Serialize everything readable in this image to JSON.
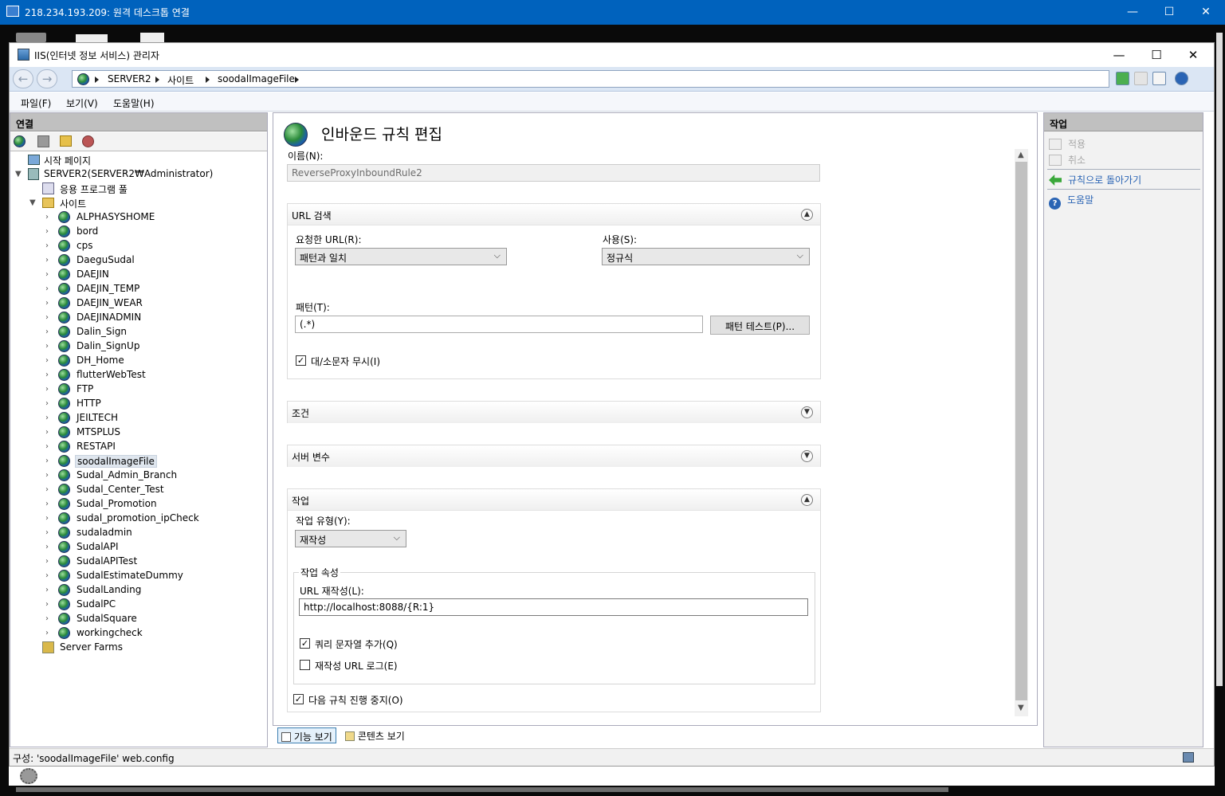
{
  "rdp": {
    "title": "218.234.193.209: 원격 데스크톱 연결",
    "minimize": "—",
    "maximize": "☐",
    "close": "✕"
  },
  "iis": {
    "title": "IIS(인터넷 정보 서비스) 관리자",
    "minimize": "—",
    "maximize": "☐",
    "close": "✕",
    "nav": {
      "back": "←",
      "forward": "→",
      "crumbs": [
        "SERVER2",
        "사이트",
        "soodalImageFile"
      ]
    },
    "menu": {
      "file": "파일(F)",
      "view": "보기(V)",
      "help": "도움말(H)"
    },
    "connections": {
      "header": "연결",
      "start_page": "시작 페이지",
      "server": "SERVER2(SERVER2₩Administrator)",
      "app_pools": "응용 프로그램 풀",
      "sites": "사이트",
      "site_list": [
        "ALPHASYSHOME",
        "bord",
        "cps",
        "DaeguSudal",
        "DAEJIN",
        "DAEJIN_TEMP",
        "DAEJIN_WEAR",
        "DAEJINADMIN",
        "Dalin_Sign",
        "Dalin_SignUp",
        "DH_Home",
        "flutterWebTest",
        "FTP",
        "HTTP",
        "JEILTECH",
        "MTSPLUS",
        "RESTAPI",
        "soodalImageFile",
        "Sudal_Admin_Branch",
        "Sudal_Center_Test",
        "Sudal_Promotion",
        "sudal_promotion_ipCheck",
        "sudaladmin",
        "SudalAPI",
        "SudalAPITest",
        "SudalEstimateDummy",
        "SudalLanding",
        "SudalPC",
        "SudalSquare",
        "workingcheck"
      ],
      "selected_site": "soodalImageFile",
      "server_farms": "Server Farms"
    },
    "editor": {
      "title": "인바운드 규칙 편집",
      "name_label": "이름(N):",
      "name_value": "ReverseProxyInboundRule2",
      "url_section": {
        "header": "URL 검색",
        "requested_label": "요청한 URL(R):",
        "requested_value": "패턴과 일치",
        "using_label": "사용(S):",
        "using_value": "정규식",
        "pattern_label": "패턴(T):",
        "pattern_value": "(.*)",
        "test_button": "패턴 테스트(P)...",
        "ignore_case_label": "대/소문자 무시(I)",
        "ignore_case_checked": true
      },
      "conditions_header": "조건",
      "server_vars_header": "서버 변수",
      "action_section": {
        "header": "작업",
        "type_label": "작업 유형(Y):",
        "type_value": "재작성",
        "props_legend": "작업 속성",
        "rewrite_label": "URL 재작성(L):",
        "rewrite_value": "http://localhost:8088/{R:1}",
        "append_query_label": "쿼리 문자열 추가(Q)",
        "append_query_checked": true,
        "log_label": "재작성 URL 로그(E)",
        "log_checked": false,
        "stop_label": "다음 규칙 진행 중지(O)",
        "stop_checked": true
      }
    },
    "views": {
      "features": "기능 보기",
      "content": "콘텐츠 보기"
    },
    "actions": {
      "header": "작업",
      "apply": "적용",
      "cancel": "취소",
      "back_to_rules": "규칙으로 돌아가기",
      "help": "도움말"
    },
    "status": "구성: 'soodalImageFile' web.config"
  },
  "colors": {
    "titlebar": "#0062bd",
    "link": "#2a64b4",
    "accent_green": "#3aa83a"
  }
}
